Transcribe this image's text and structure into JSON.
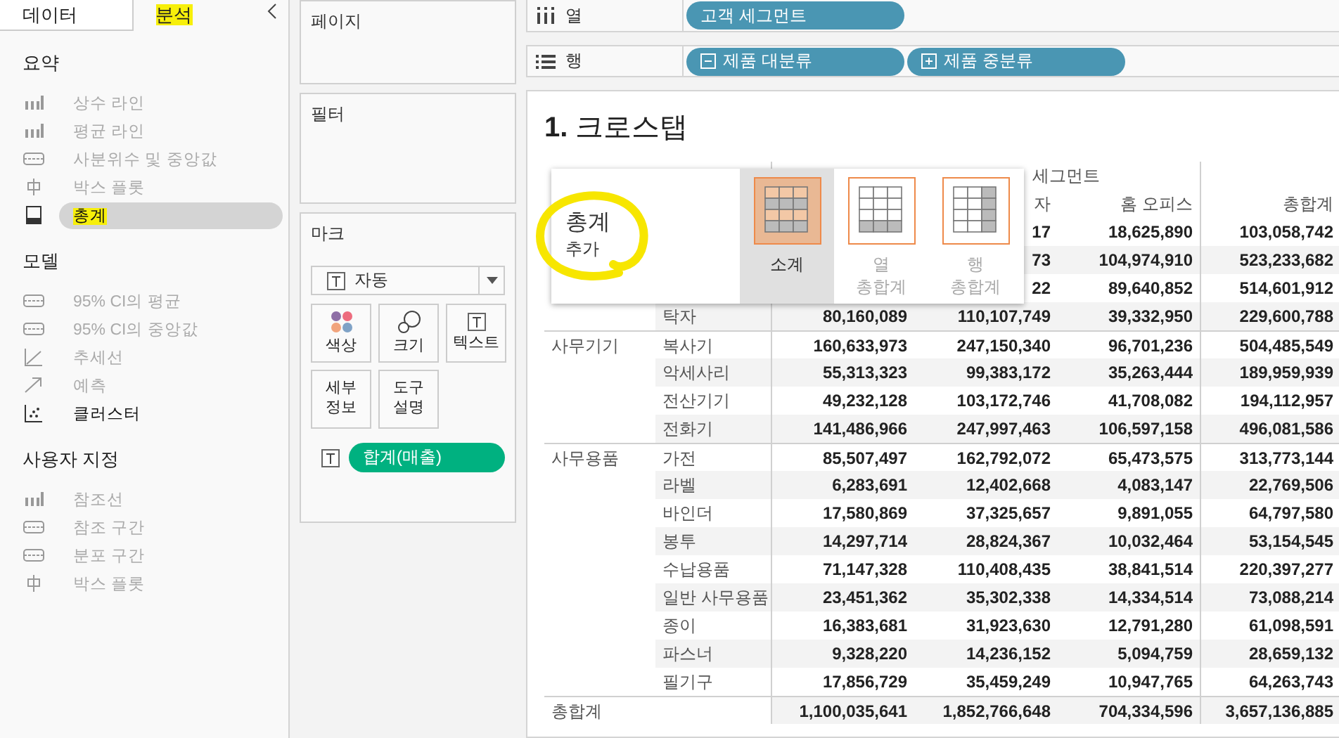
{
  "side_tabs": [
    {
      "label": "데이터",
      "selected": false,
      "highlighted": false
    },
    {
      "label": "분석",
      "selected": true,
      "highlighted": true
    }
  ],
  "analytics": [
    {
      "title": "요약",
      "items": [
        {
          "label": "상수 라인",
          "kind": "dots",
          "enabled": false,
          "selected": false,
          "highlighted": false
        },
        {
          "label": "평균 라인",
          "kind": "dots",
          "enabled": false,
          "selected": false,
          "highlighted": false
        },
        {
          "label": "사분위수 및 중앙값",
          "kind": "band",
          "enabled": false,
          "selected": false,
          "highlighted": false
        },
        {
          "label": "박스 플롯",
          "kind": "box",
          "enabled": false,
          "selected": false,
          "highlighted": false
        },
        {
          "label": "총계",
          "kind": "total",
          "enabled": true,
          "selected": true,
          "highlighted": true
        }
      ]
    },
    {
      "title": "모델",
      "items": [
        {
          "label": "95% CI의 평균",
          "kind": "band",
          "enabled": false,
          "selected": false,
          "highlighted": false
        },
        {
          "label": "95% CI의 중앙값",
          "kind": "band",
          "enabled": false,
          "selected": false,
          "highlighted": false
        },
        {
          "label": "추세선",
          "kind": "trend",
          "enabled": false,
          "selected": false,
          "highlighted": false
        },
        {
          "label": "예측",
          "kind": "forecast",
          "enabled": false,
          "selected": false,
          "highlighted": false
        },
        {
          "label": "클러스터",
          "kind": "cluster",
          "enabled": true,
          "selected": false,
          "highlighted": false
        }
      ]
    },
    {
      "title": "사용자 지정",
      "items": [
        {
          "label": "참조선",
          "kind": "dots",
          "enabled": false,
          "selected": false,
          "highlighted": false
        },
        {
          "label": "참조 구간",
          "kind": "band",
          "enabled": false,
          "selected": false,
          "highlighted": false
        },
        {
          "label": "분포 구간",
          "kind": "band",
          "enabled": false,
          "selected": false,
          "highlighted": false
        },
        {
          "label": "박스 플롯",
          "kind": "box",
          "enabled": false,
          "selected": false,
          "highlighted": false
        }
      ]
    }
  ],
  "pages_shelf": {
    "title": "페이지"
  },
  "filters_shelf": {
    "title": "필터"
  },
  "marks": {
    "title": "마크",
    "type": "자동",
    "buttons": [
      {
        "label": "색상",
        "kind": "color"
      },
      {
        "label": "크기",
        "kind": "size"
      },
      {
        "label": "텍스트",
        "kind": "text"
      },
      {
        "label": "세부\n정보",
        "kind": "plain"
      },
      {
        "label": "도구\n설명",
        "kind": "plain"
      }
    ],
    "field": "합계(매출)"
  },
  "columns_shelf": {
    "label": "열",
    "pills": [
      {
        "label": "고객 세그먼트"
      }
    ]
  },
  "rows_shelf": {
    "label": "행",
    "pills": [
      {
        "label": "제품 대분류",
        "kind": "collapsible"
      },
      {
        "label": "제품 중분류",
        "kind": "expandable"
      }
    ]
  },
  "sheet_title": "**1.** 크로스탭",
  "table": {
    "header_top": "세그먼트",
    "columns": [
      null,
      "자",
      "홈 오피스",
      "총합계"
    ],
    "groups": [
      {
        "rows": [
          {
            "cells": [
              null,
              "17",
              "18,625,890",
              "103,058,742"
            ]
          },
          {
            "cells": [
              null,
              "73",
              "104,974,910",
              "523,233,682"
            ]
          },
          {
            "cells": [
              null,
              "22",
              "89,640,852",
              "514,601,912"
            ]
          },
          {
            "label": "탁자",
            "cells": [
              "80,160,089",
              "110,107,749",
              "39,332,950",
              "229,600,788"
            ]
          }
        ]
      },
      {
        "category": "사무기기",
        "rows": [
          {
            "label": "복사기",
            "cells": [
              "160,633,973",
              "247,150,340",
              "96,701,236",
              "504,485,549"
            ]
          },
          {
            "label": "악세사리",
            "cells": [
              "55,313,323",
              "99,383,172",
              "35,263,444",
              "189,959,939"
            ]
          },
          {
            "label": "전산기기",
            "cells": [
              "49,232,128",
              "103,172,746",
              "41,708,082",
              "194,112,957"
            ]
          },
          {
            "label": "전화기",
            "cells": [
              "141,486,966",
              "247,997,463",
              "106,597,158",
              "496,081,586"
            ]
          }
        ]
      },
      {
        "category": "사무용품",
        "rows": [
          {
            "label": "가전",
            "cells": [
              "85,507,497",
              "162,792,072",
              "65,473,575",
              "313,773,144"
            ]
          },
          {
            "label": "라벨",
            "cells": [
              "6,283,691",
              "12,402,668",
              "4,083,147",
              "22,769,506"
            ]
          },
          {
            "label": "바인더",
            "cells": [
              "17,580,869",
              "37,325,657",
              "9,891,055",
              "64,797,580"
            ]
          },
          {
            "label": "봉투",
            "cells": [
              "14,297,714",
              "28,824,367",
              "10,032,464",
              "53,154,545"
            ]
          },
          {
            "label": "수납용품",
            "cells": [
              "71,147,328",
              "110,408,435",
              "38,841,514",
              "220,397,277"
            ]
          },
          {
            "label": "일반 사무용품",
            "cells": [
              "23,451,362",
              "35,302,338",
              "14,334,514",
              "73,088,214"
            ]
          },
          {
            "label": "종이",
            "cells": [
              "16,383,681",
              "31,923,630",
              "12,791,280",
              "61,098,591"
            ]
          },
          {
            "label": "파스너",
            "cells": [
              "9,328,220",
              "14,236,152",
              "5,094,759",
              "28,659,132"
            ]
          },
          {
            "label": "필기구",
            "cells": [
              "17,856,729",
              "35,459,249",
              "10,947,765",
              "64,263,743"
            ]
          }
        ]
      }
    ],
    "total": {
      "label": "총합계",
      "cells": [
        "1,100,035,641",
        "1,852,766,648",
        "704,334,596",
        "3,657,136,885"
      ]
    }
  },
  "popup": {
    "title": "총계",
    "subtitle": "추가",
    "options": [
      {
        "label": "소계",
        "kind": "subtotal",
        "selected": true,
        "disabled": false
      },
      {
        "label": "열\n총합계",
        "kind": "column",
        "selected": false,
        "disabled": true
      },
      {
        "label": "행\n총합계",
        "kind": "row",
        "selected": false,
        "disabled": true
      }
    ]
  }
}
